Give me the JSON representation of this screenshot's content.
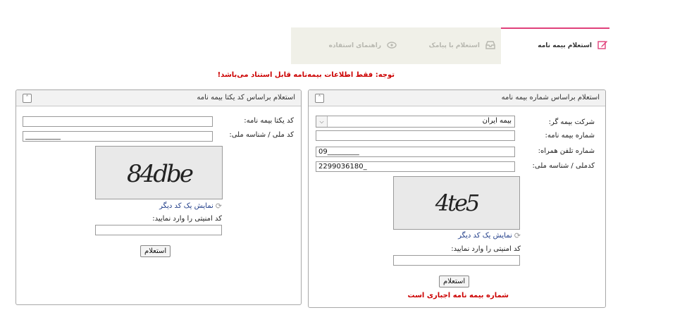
{
  "tabs": {
    "active": {
      "label": "استعلام بیمه نامه",
      "icon": "edit-icon"
    },
    "sms": {
      "label": "استعلام با پیامک",
      "icon": "inbox-icon"
    },
    "guide": {
      "label": "راهنمای استفاده",
      "icon": "eye-icon"
    }
  },
  "notice": "توجه: فقط اطلاعات بیمه‌نامه قابل استناد می‌باشد!",
  "right_panel": {
    "title": "استعلام براساس شماره بیمه نامه",
    "insurer_label": "شرکت بیمه گر:",
    "insurer_value": "بیمه ایران",
    "policy_number_label": "شماره بیمه نامه:",
    "policy_number_value": "",
    "phone_label": "شماره تلفن همراه:",
    "phone_value": "09_________",
    "national_id_label": "کدملی / شناسه ملی:",
    "national_id_value": "2299036180_",
    "captcha_text": "4te5",
    "refresh_label": "نمایش یک کد دیگر",
    "security_code_label": "کد امنیتی را وارد نمایید:",
    "security_code_value": "",
    "submit_label": "استعلام",
    "required_note": "شماره بیمه نامه اجباری است"
  },
  "left_panel": {
    "title": "استعلام براساس کد یکتا بیمه نامه",
    "unique_code_label": "کد یکتا بیمه نامه:",
    "unique_code_value": "",
    "national_id_label": "کد ملی / شناسه ملی:",
    "national_id_value": "__________",
    "captcha_text": "84dbe",
    "refresh_label": "نمایش یک کد دیگر",
    "security_code_label": "کد امنیتی را وارد نمایید:",
    "security_code_value": "",
    "submit_label": "استعلام"
  },
  "colors": {
    "accent": "#e0407a",
    "alert": "#cc0000",
    "link": "#1f3c88"
  }
}
